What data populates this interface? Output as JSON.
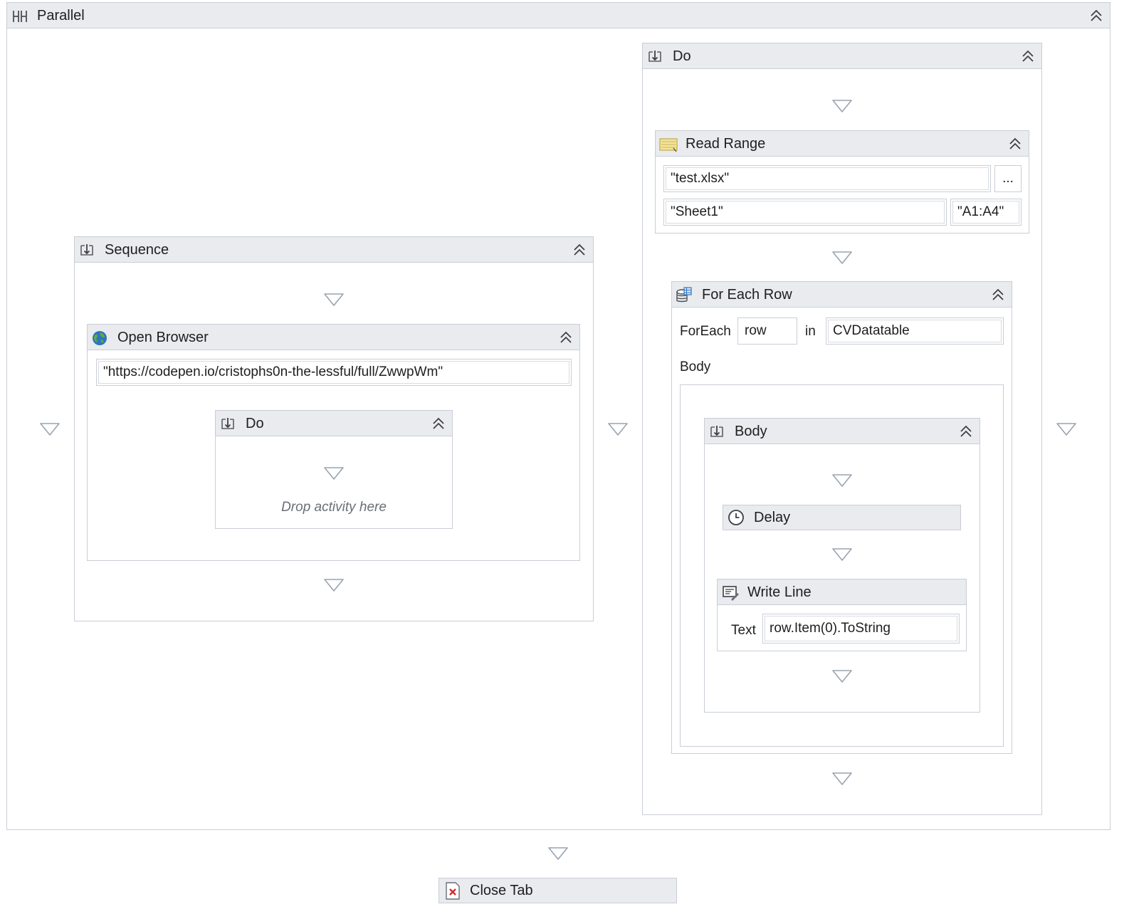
{
  "parallel": {
    "title": "Parallel"
  },
  "sequence": {
    "title": "Sequence"
  },
  "open_browser": {
    "title": "Open Browser",
    "url": "\"https://codepen.io/cristophs0n-the-lessful/full/ZwwpWm\""
  },
  "inner_do": {
    "title": "Do",
    "placeholder": "Drop activity here"
  },
  "right_do": {
    "title": "Do"
  },
  "read_range": {
    "title": "Read Range",
    "file": "\"test.xlsx\"",
    "browse_label": "...",
    "sheet": "\"Sheet1\"",
    "range": "\"A1:A4\""
  },
  "for_each_row": {
    "title": "For Each Row",
    "foreach_label": "ForEach",
    "item_var": "row",
    "in_label": "in",
    "collection": "CVDatatable",
    "body_label": "Body"
  },
  "body_seq": {
    "title": "Body"
  },
  "delay": {
    "title": "Delay"
  },
  "write_line": {
    "title": "Write Line",
    "text_label": "Text",
    "text_value": "row.Item(0).ToString"
  },
  "close_tab": {
    "title": "Close Tab"
  },
  "icons": {
    "parallel": "parallel-icon",
    "sequence": "sequence-icon",
    "browser": "globe-icon",
    "excel": "excel-read-range-icon",
    "foreach": "for-each-row-icon",
    "delay": "clock-icon",
    "writeline": "write-line-icon",
    "closetab": "close-tab-icon",
    "collapse": "collapse-chevron-icon",
    "drop": "drop-target-triangle-icon"
  }
}
